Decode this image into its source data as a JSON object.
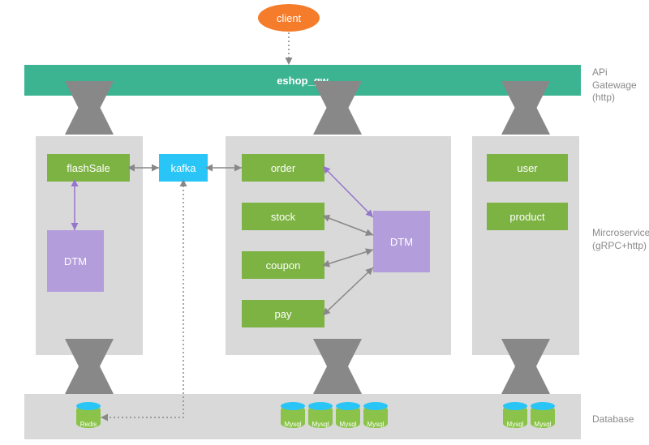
{
  "layers": {
    "gateway": "APi Gatewage\n(http)",
    "microservices": "Mircroservices\n(gRPC+http)",
    "database": "Database"
  },
  "nodes": {
    "client": "client",
    "gateway": "eshop_gw",
    "flashSale": "flashSale",
    "kafka": "kafka",
    "dtm_left": "DTM",
    "order": "order",
    "stock": "stock",
    "coupon": "coupon",
    "pay": "pay",
    "dtm_center": "DTM",
    "user": "user",
    "product": "product",
    "redis": "Redis",
    "mysql": "Mysql"
  }
}
